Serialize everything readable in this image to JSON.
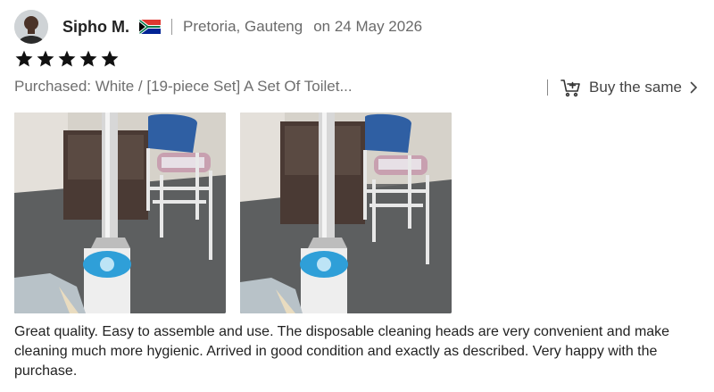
{
  "review": {
    "reviewer_name": "Sipho M.",
    "location": "Pretoria, Gauteng",
    "date": "on 24 May 2026",
    "rating": 5,
    "purchased": "Purchased: White / [19-piece Set] A Set Of Toilet...",
    "buy_same_label": "Buy the same",
    "text": "Great quality. Easy to assemble and use. The disposable cleaning heads are very convenient and make cleaning much more hygienic. Arrived in good condition and exactly as described. Very happy with the purchase.",
    "photos": [
      "review-photo-1",
      "review-photo-2"
    ]
  },
  "colors": {
    "star": "#111111",
    "muted_text": "#6a6a6a",
    "cleaner_blue": "#2f9fd8",
    "chair_blue": "#2f5fa3"
  },
  "icons": {
    "flag": "south-africa-flag-icon",
    "cart": "cart-plus-icon",
    "chevron": "chevron-right-icon",
    "star": "star-icon"
  }
}
